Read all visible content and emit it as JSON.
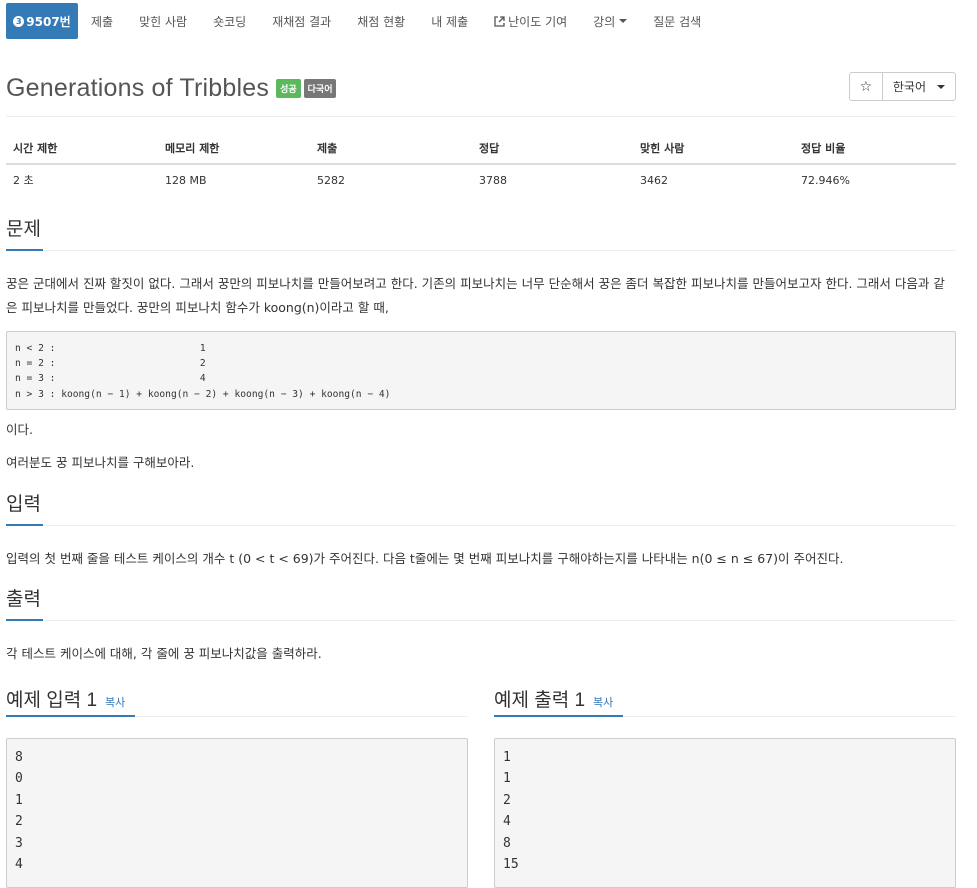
{
  "nav": {
    "problem_number": "9507번",
    "tier_glyph": "3",
    "items": [
      "제출",
      "맞힌 사람",
      "숏코딩",
      "재채점 결과",
      "채점 현황",
      "내 제출",
      "난이도 기여",
      "강의",
      "질문 검색"
    ]
  },
  "problem": {
    "title": "Generations of Tribbles",
    "badge_success": "성공",
    "badge_multilang": "다국어",
    "star": "☆",
    "language": "한국어"
  },
  "stats": {
    "headers": [
      "시간 제한",
      "메모리 제한",
      "제출",
      "정답",
      "맞힌 사람",
      "정답 비율"
    ],
    "values": [
      "2 초",
      "128 MB",
      "5282",
      "3788",
      "3462",
      "72.946%"
    ]
  },
  "sections": {
    "problem_heading": "문제",
    "problem_text_1": "꿍은 군대에서 진짜 할짓이 없다. 그래서 꿍만의 피보나치를 만들어보려고 한다. 기존의 피보나치는 너무 단순해서 꿍은 좀더 복잡한 피보나치를 만들어보고자 한다. 그래서 다음과 같은 피보나치를 만들었다. 꿍만의 피보나치 함수가 koong(n)이라고 할 때,",
    "formula": "n < 2 :                         1\nn = 2 :                         2\nn = 3 :                         4\nn > 3 : koong(n − 1) + koong(n − 2) + koong(n − 3) + koong(n − 4)",
    "problem_text_2": "이다.",
    "problem_text_3": "여러분도 꿍 피보나치를 구해보아라.",
    "input_heading": "입력",
    "input_text": "입력의 첫 번째 줄을 테스트 케이스의 개수 t (0 < t < 69)가 주어진다. 다음 t줄에는 몇 번째 피보나치를 구해야하는지를 나타내는 n(0 ≤ n ≤ 67)이 주어진다.",
    "output_heading": "출력",
    "output_text": "각 테스트 케이스에 대해, 각 줄에 꿍 피보나치값을 출력하라."
  },
  "samples": {
    "input_heading": "예제 입력 1",
    "output_heading": "예제 출력 1",
    "copy_label": "복사",
    "input": "8\n0\n1\n2\n3\n4",
    "output": "1\n1\n2\n4\n8\n15"
  }
}
